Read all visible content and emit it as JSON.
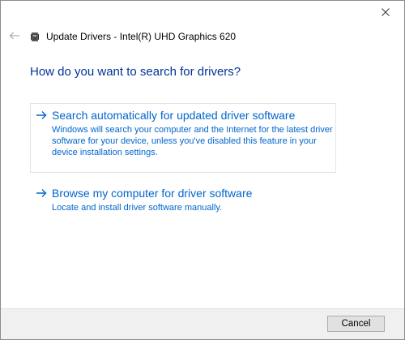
{
  "window": {
    "title": "Update Drivers - Intel(R) UHD Graphics 620",
    "close_icon": "close-icon",
    "back_icon": "back-arrow-icon",
    "device_icon": "display-adapter-icon"
  },
  "main": {
    "question": "How do you want to search for drivers?",
    "options": [
      {
        "title": "Search automatically for updated driver software",
        "description": "Windows will search your computer and the Internet for the latest driver software for your device, unless you've disabled this feature in your device installation settings.",
        "icon": "right-arrow-icon"
      },
      {
        "title": "Browse my computer for driver software",
        "description": "Locate and install driver software manually.",
        "icon": "right-arrow-icon"
      }
    ]
  },
  "footer": {
    "cancel_label": "Cancel"
  },
  "colors": {
    "heading": "#003399",
    "link": "#0066cc",
    "footer_bg": "#f0f0f0"
  }
}
